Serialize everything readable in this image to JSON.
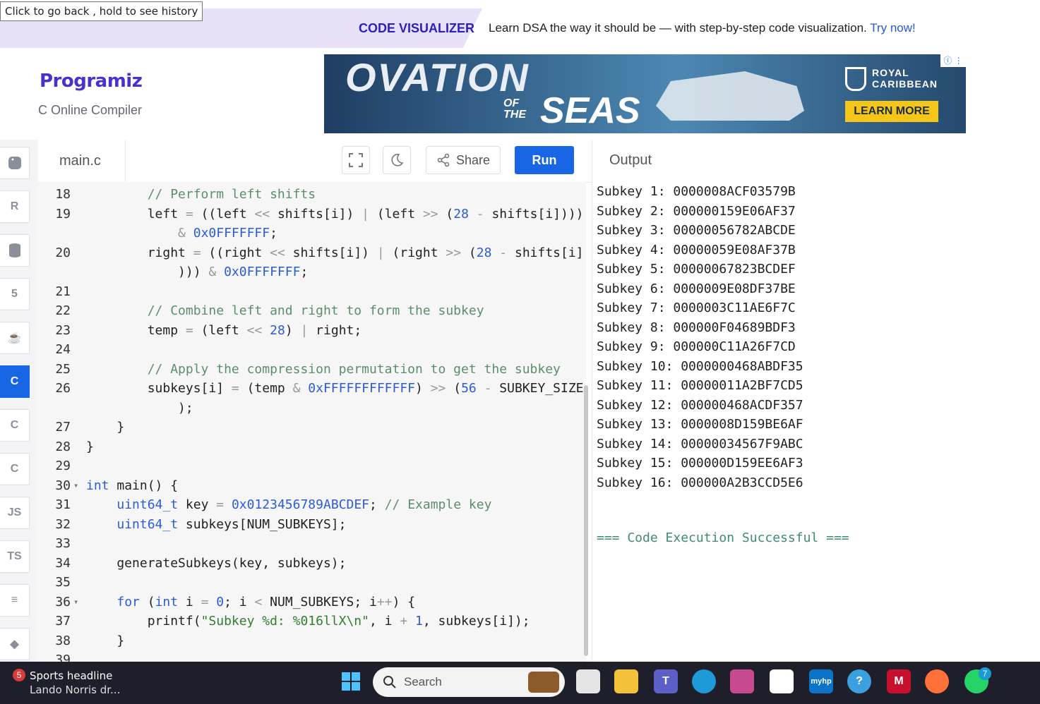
{
  "tooltip": "Click to go back , hold to see history",
  "banner": {
    "label": "CODE VISUALIZER",
    "text": "Learn DSA the way it should be — with step-by-step code visualization.",
    "link": "Try now!"
  },
  "brand": {
    "logo": "Programiz",
    "subtitle": "C Online Compiler"
  },
  "ad": {
    "line1": "OVATION",
    "of": "OF",
    "the": "THE",
    "seas": "SEAS",
    "brand1": "ROYAL",
    "brand2": "CARIBBEAN",
    "cta": "LEARN MORE",
    "info": "ⓘ ⋮"
  },
  "sidebar": {
    "items": [
      "python",
      "r",
      "sql",
      "html",
      "java",
      "c",
      "cpp",
      "csharp",
      "JS",
      "TS",
      "swift",
      "go"
    ]
  },
  "editor": {
    "filename": "main.c",
    "share": "Share",
    "run": "Run"
  },
  "output": {
    "title": "Output",
    "lines": [
      "Subkey 1: 0000008ACF03579B",
      "Subkey 2: 000000159E06AF37",
      "Subkey 3: 00000056782ABCDE",
      "Subkey 4: 00000059E08AF37B",
      "Subkey 5: 00000067823BCDEF",
      "Subkey 6: 0000009E08DF37BE",
      "Subkey 7: 0000003C11AE6F7C",
      "Subkey 8: 000000F04689BDF3",
      "Subkey 9: 000000C11A26F7CD",
      "Subkey 10: 0000000468ABDF35",
      "Subkey 11: 00000011A2BF7CD5",
      "Subkey 12: 000000468ACDF357",
      "Subkey 13: 0000008D159BE6AF",
      "Subkey 14: 00000034567F9ABC",
      "Subkey 15: 000000D159EE6AF3",
      "Subkey 16: 000000A2B3CCD5E6"
    ],
    "success": "=== Code Execution Successful ==="
  },
  "code_lines": [
    {
      "n": "18",
      "t": "        // Perform left shifts"
    },
    {
      "n": "19",
      "t": "        left = ((left << shifts[i]) | (left >> (28 - shifts[i])))"
    },
    {
      "n": "",
      "t": "            & 0x0FFFFFFF;"
    },
    {
      "n": "20",
      "t": "        right = ((right << shifts[i]) | (right >> (28 - shifts[i]"
    },
    {
      "n": "",
      "t": "            ))) & 0x0FFFFFFF;"
    },
    {
      "n": "21",
      "t": ""
    },
    {
      "n": "22",
      "t": "        // Combine left and right to form the subkey"
    },
    {
      "n": "23",
      "t": "        temp = (left << 28) | right;"
    },
    {
      "n": "24",
      "t": ""
    },
    {
      "n": "25",
      "t": "        // Apply the compression permutation to get the subkey"
    },
    {
      "n": "26",
      "t": "        subkeys[i] = (temp & 0xFFFFFFFFFFFF) >> (56 - SUBKEY_SIZE"
    },
    {
      "n": "",
      "t": "            );"
    },
    {
      "n": "27",
      "t": "    }"
    },
    {
      "n": "28",
      "t": "}"
    },
    {
      "n": "29",
      "t": ""
    },
    {
      "n": "30",
      "t": "int main() {"
    },
    {
      "n": "31",
      "t": "    uint64_t key = 0x0123456789ABCDEF; // Example key"
    },
    {
      "n": "32",
      "t": "    uint64_t subkeys[NUM_SUBKEYS];"
    },
    {
      "n": "33",
      "t": ""
    },
    {
      "n": "34",
      "t": "    generateSubkeys(key, subkeys);"
    },
    {
      "n": "35",
      "t": ""
    },
    {
      "n": "36",
      "t": "    for (int i = 0; i < NUM_SUBKEYS; i++) {"
    },
    {
      "n": "37",
      "t": "        printf(\"Subkey %d: %016llX\\n\", i + 1, subkeys[i]);"
    },
    {
      "n": "38",
      "t": "    }"
    },
    {
      "n": "39",
      "t": ""
    }
  ],
  "taskbar": {
    "news_badge": "5",
    "news_title": "Sports headline",
    "news_sub": "Lando Norris dr...",
    "search": "Search",
    "whatsapp_badge": "7"
  }
}
